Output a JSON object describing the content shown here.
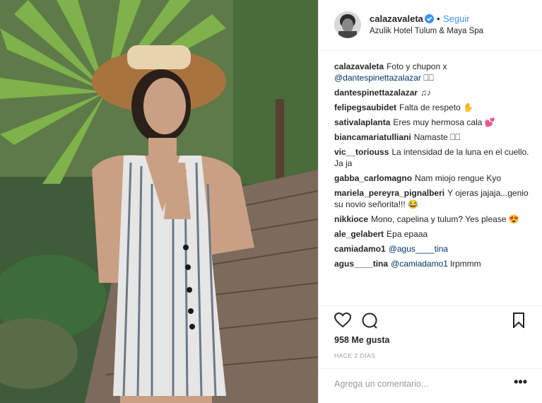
{
  "post": {
    "username": "calazavaleta",
    "separator": "•",
    "follow_label": "Seguir",
    "location": "Azulik Hotel Tulum & Maya Spa"
  },
  "comments": [
    {
      "user": "calazavaleta",
      "text": "Foto y chupon x",
      "mention": "@dantespinettazalazar",
      "suffix": "⎕⎕"
    },
    {
      "user": "dantespinettazalazar",
      "text": "♫♪"
    },
    {
      "user": "felipegsaubidet",
      "text": "Falta de respeto",
      "emoji": "✋"
    },
    {
      "user": "sativalaplanta",
      "text": "Eres muy hermosa cala",
      "emoji": "💕"
    },
    {
      "user": "biancamariatulliani",
      "text": "Namaste ⎕⎕"
    },
    {
      "user": "vic__toriouss",
      "text": "La intensidad de la luna en el cuello. Ja ja"
    },
    {
      "user": "gabba_carlomagno",
      "text": "Nam miojo rengue Kyo"
    },
    {
      "user": "mariela_pereyra_pignalberi",
      "text": "Y ojeras jajaja...genio su novio señorita!!!",
      "emoji": "😂"
    },
    {
      "user": "nikkioce",
      "text": "Mono, capelina y tulum? Yes please",
      "emoji": "😍"
    },
    {
      "user": "ale_gelabert",
      "text": "Epa epaaa"
    },
    {
      "user": "camiadamo1",
      "mention": "@agus____tina"
    },
    {
      "user": "agus____tina",
      "mention": "@camiadamo1",
      "text": "lrpmmm"
    }
  ],
  "likes": "958 Me gusta",
  "timestamp": "HACE 2 DÍAS",
  "comment_placeholder": "Agrega un comentario...",
  "more_label": "•••",
  "icons": [
    "heart-icon",
    "comment-icon",
    "bookmark-icon",
    "verified-icon"
  ],
  "colors": {
    "link": "#3897f0",
    "mention": "#003569",
    "text": "#262626",
    "muted": "#999999"
  }
}
